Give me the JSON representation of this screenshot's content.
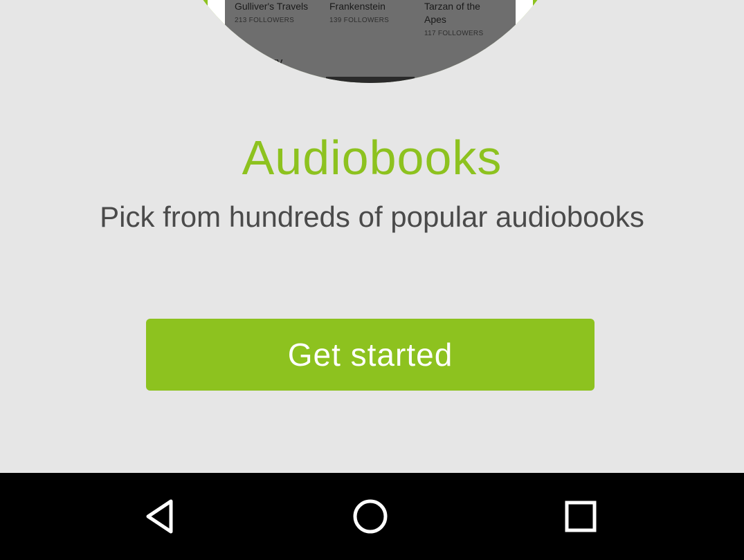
{
  "preview": {
    "books": [
      {
        "title": "Gulliver's Travels",
        "followers": "213 FOLLOWERS"
      },
      {
        "title": "Frankenstein",
        "followers": "139 FOLLOWERS"
      },
      {
        "title": "Tarzan of the\nApes",
        "followers": "117 FOLLOWERS"
      }
    ],
    "section_label": "tery"
  },
  "onboarding": {
    "title": "Audiobooks",
    "subtitle": "Pick from hundreds of popular audiobooks",
    "cta_label": "Get started"
  },
  "navbar": {
    "back_icon": "back-triangle-icon",
    "home_icon": "home-circle-icon",
    "recents_icon": "recents-square-icon"
  },
  "colors": {
    "accent": "#8dc21f",
    "background": "#e6e6e6",
    "subtitle": "#4a4a4a",
    "navbar": "#000000"
  }
}
